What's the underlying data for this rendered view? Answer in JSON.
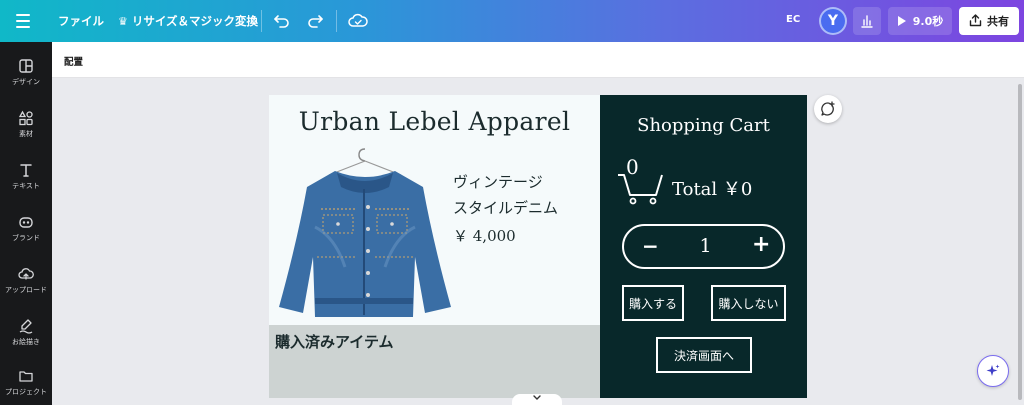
{
  "topbar": {
    "menu_icon": "hamburger-icon",
    "file_label": "ファイル",
    "resize_label": "リサイズ＆マジック変換",
    "resize_icon": "sparkle-crown-icon",
    "undo_icon": "undo-icon",
    "redo_icon": "redo-icon",
    "cloud_icon": "cloud-saved-icon",
    "ec_label": "EC",
    "avatar_letter": "Y",
    "stats_icon": "bar-chart-icon",
    "play_label": "9.0秒",
    "share_label": "共有",
    "gradient_colors": [
      "#10b8c8",
      "#5b6ee0",
      "#7d45e0"
    ]
  },
  "sidebar": {
    "items": [
      {
        "label": "デザイン",
        "icon": "design-layout-icon"
      },
      {
        "label": "素材",
        "icon": "shapes-icon"
      },
      {
        "label": "テキスト",
        "icon": "text-icon"
      },
      {
        "label": "ブランド",
        "icon": "brand-icon"
      },
      {
        "label": "アップロード",
        "icon": "upload-cloud-icon"
      },
      {
        "label": "お絵描き",
        "icon": "draw-icon"
      },
      {
        "label": "プロジェクト",
        "icon": "folder-icon"
      }
    ]
  },
  "context_bar": {
    "arrange_label": "配置"
  },
  "design": {
    "shop_name": "Urban Lebel Apparel",
    "product_name_line1": "ヴィンテージ",
    "product_name_line2": "スタイルデニム",
    "price": "￥ 4,000",
    "purchased_label": "購入済みアイテム",
    "cart": {
      "title": "Shopping Cart",
      "count": "0",
      "total": "Total ￥0",
      "quantity_minus": "−",
      "quantity": "1",
      "quantity_plus": "+",
      "buy_label": "購入する",
      "no_buy_label": "購入しない",
      "checkout_label": "決済画面へ"
    },
    "colors": {
      "left_bg": "#f5fafb",
      "cart_bg": "#08282a",
      "bottom_bg": "#cdd3d2",
      "denim": "#3a6ea5"
    }
  }
}
